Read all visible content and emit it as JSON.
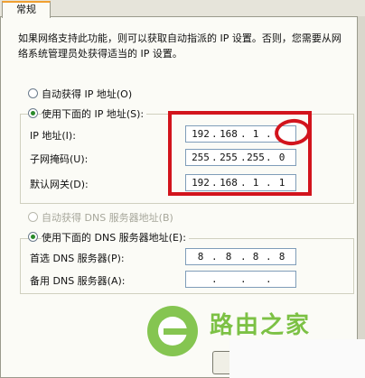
{
  "tab": {
    "label": "常规"
  },
  "intro": {
    "text": "如果网络支持此功能，则可以获取自动指派的 IP 设置。否则，您需要从网络系统管理员处获得适当的 IP 设置。"
  },
  "ip_mode": {
    "auto_label": "自动获得 IP 地址(O)",
    "manual_label": "使用下面的 IP 地址(S):"
  },
  "ip": {
    "address_label": "IP 地址(I):",
    "address": [
      "192",
      "168",
      "1",
      ""
    ],
    "mask_label": "子网掩码(U):",
    "mask": [
      "255",
      "255",
      "255",
      "0"
    ],
    "gateway_label": "默认网关(D):",
    "gateway": [
      "192",
      "168",
      "1",
      "1"
    ]
  },
  "dns_mode": {
    "auto_label": "自动获得 DNS 服务器地址(B)",
    "manual_label": "使用下面的 DNS 服务器地址(E):"
  },
  "dns": {
    "preferred_label": "首选 DNS 服务器(P):",
    "preferred": [
      "8",
      "8",
      "8",
      "8"
    ],
    "alternate_label": "备用 DNS 服务器(A):",
    "alternate": [
      "",
      "",
      "",
      ""
    ]
  },
  "watermark": {
    "name": "路由之家"
  },
  "colors": {
    "highlight": "#d2141c",
    "watermark": "#7cc144",
    "selected_dot": "#2a8a2a"
  }
}
